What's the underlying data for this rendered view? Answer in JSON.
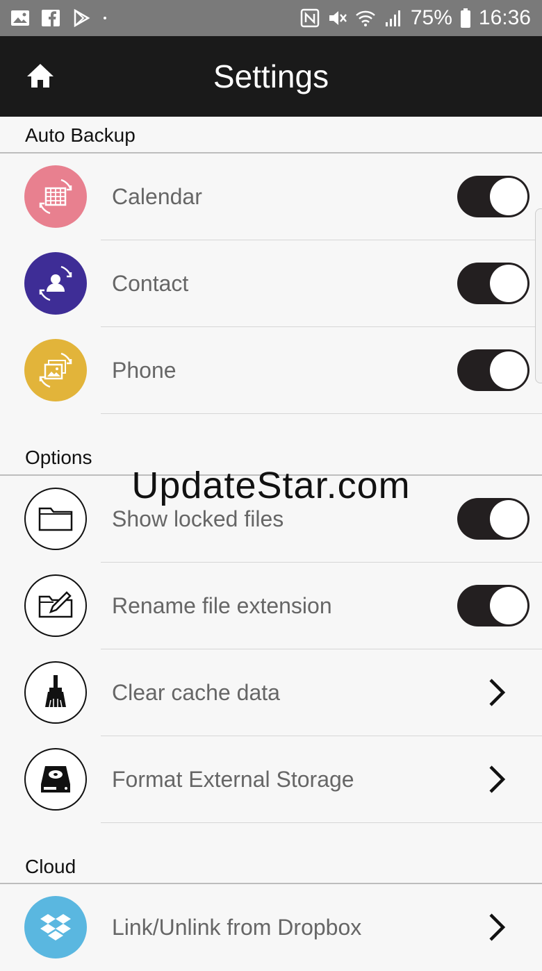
{
  "status_bar": {
    "battery": "75%",
    "time": "16:36",
    "icons": [
      "gallery-icon",
      "facebook-icon",
      "play-store-icon",
      "nfc-icon",
      "mute-icon",
      "wifi-icon",
      "signal-icon",
      "battery-icon"
    ]
  },
  "app_bar": {
    "title": "Settings",
    "home_icon": "home-icon"
  },
  "sections": {
    "auto_backup": {
      "title": "Auto Backup",
      "items": [
        {
          "label": "Calendar",
          "icon": "calendar-sync-icon",
          "color": "#e8808f",
          "toggle": true
        },
        {
          "label": "Contact",
          "icon": "contact-sync-icon",
          "color": "#3e2d96",
          "toggle": true
        },
        {
          "label": "Phone",
          "icon": "photo-sync-icon",
          "color": "#e2b43a",
          "toggle": true
        }
      ]
    },
    "options": {
      "title": "Options",
      "items": [
        {
          "label": "Show locked files",
          "icon": "folder-icon",
          "toggle": true
        },
        {
          "label": "Rename file extension",
          "icon": "folder-edit-icon",
          "toggle": true
        },
        {
          "label": "Clear cache data",
          "icon": "broom-icon"
        },
        {
          "label": "Format External Storage",
          "icon": "hard-drive-icon"
        }
      ]
    },
    "cloud": {
      "title": "Cloud",
      "items": [
        {
          "label": "Link/Unlink from Dropbox",
          "icon": "dropbox-icon",
          "color": "#5ab7e0"
        }
      ]
    }
  },
  "watermark": "UpdateStar.com"
}
